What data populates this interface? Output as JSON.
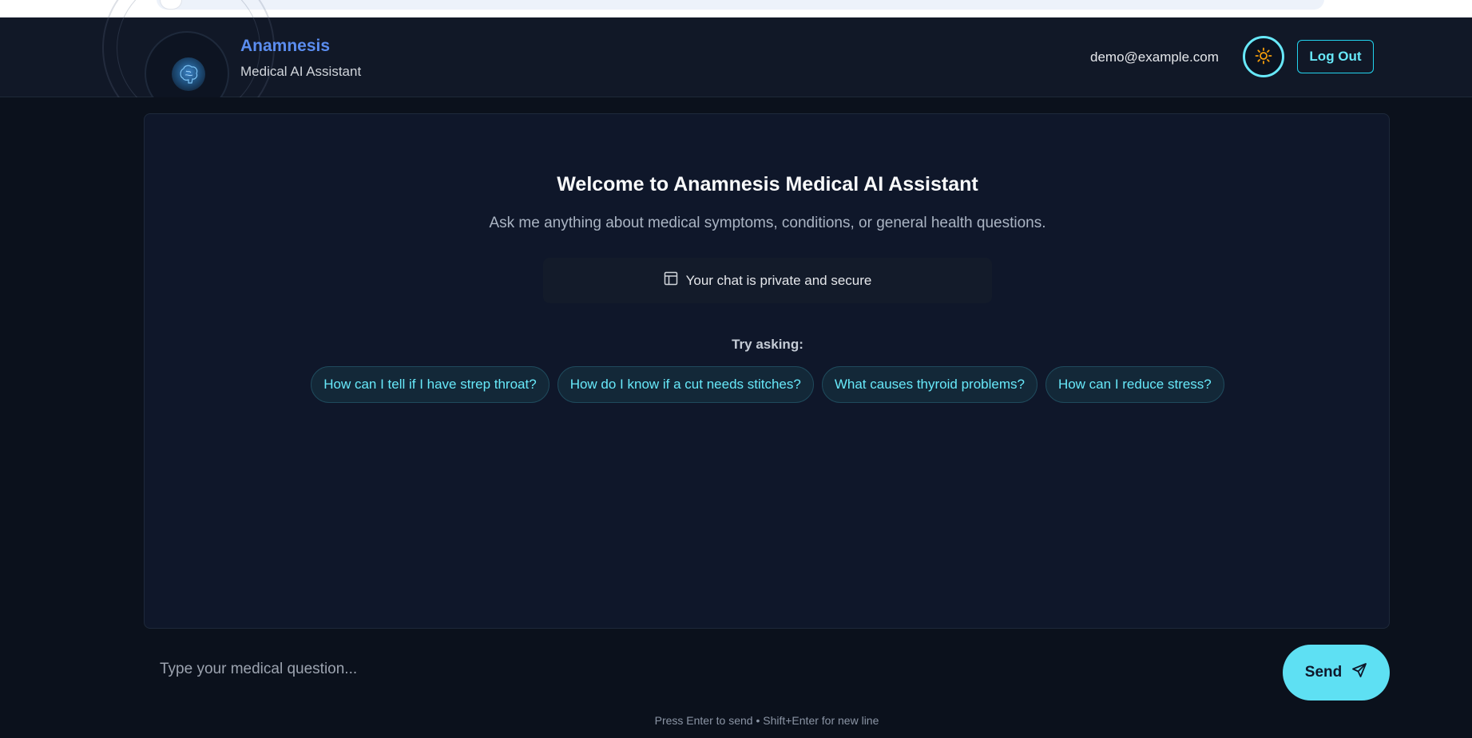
{
  "brand": {
    "name": "Anamnesis",
    "subtitle": "Medical AI Assistant"
  },
  "header": {
    "user_email": "demo@example.com",
    "theme_icon": "sun-icon",
    "logout_label": "Log Out"
  },
  "welcome": {
    "title": "Welcome to Anamnesis Medical AI Assistant",
    "subtitle": "Ask me anything about medical symptoms, conditions, or general health questions.",
    "privacy_text": "Your chat is private and secure",
    "privacy_icon": "layout-icon"
  },
  "suggestions": {
    "label": "Try asking:",
    "items": [
      "How can I tell if I have strep throat?",
      "How do I know if a cut needs stitches?",
      "What causes thyroid problems?",
      "How can I reduce stress?"
    ]
  },
  "composer": {
    "placeholder": "Type your medical question...",
    "send_label": "Send",
    "send_icon": "send-icon",
    "hint": "Press Enter to send • Shift+Enter for new line"
  },
  "colors": {
    "accent": "#22d3ee",
    "brand": "#5b8def",
    "sun": "#f59e0b",
    "background": "#0b111c"
  }
}
